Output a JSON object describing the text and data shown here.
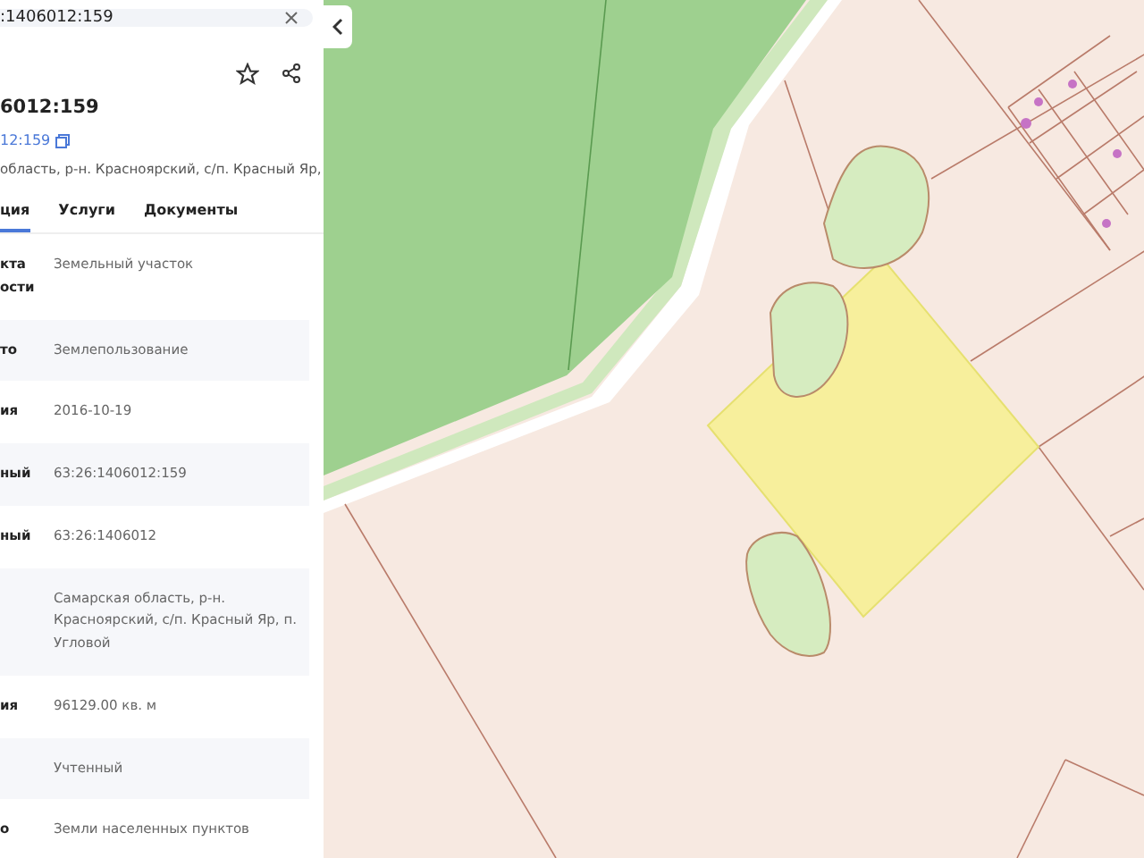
{
  "search": {
    "value": ":1406012:159"
  },
  "card": {
    "title": "6012:159",
    "cadastral_link": "12:159",
    "address": "область, р-н. Красноярский, с/п. Красный Яр,",
    "tabs": [
      {
        "label": "ция",
        "selected": true
      },
      {
        "label": "Услуги",
        "selected": false
      },
      {
        "label": "Документы",
        "selected": false
      }
    ],
    "rows": [
      {
        "label": "кта\nости",
        "value": "Земельный участок"
      },
      {
        "label": "то",
        "value": "Землепользование"
      },
      {
        "label": "ия",
        "value": "2016-10-19"
      },
      {
        "label": "ный",
        "value": "63:26:1406012:159"
      },
      {
        "label": "ный",
        "value": "63:26:1406012"
      },
      {
        "value": "Самарская область, р-н. Красноярский, с/п. Красный Яр, п. Угловой"
      },
      {
        "label": "ия",
        "value": "96129.00 кв. м"
      },
      {
        "value": "Учтенный"
      },
      {
        "label": "о",
        "value": "Земли населенных пунктов"
      }
    ]
  }
}
